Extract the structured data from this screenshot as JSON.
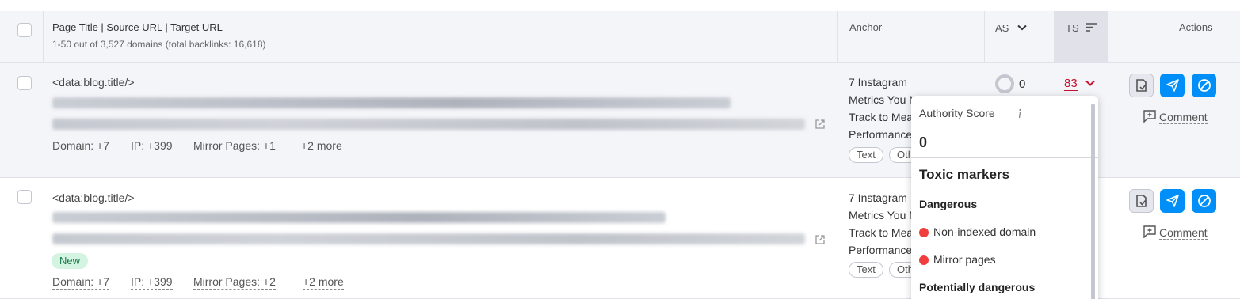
{
  "header": {
    "page_title_col": "Page Title | Source URL | Target URL",
    "summary": "1-50 out of 3,527 domains (total backlinks: 16,618)",
    "anchor_col": "Anchor",
    "as_col": "AS",
    "ts_col": "TS",
    "actions_col": "Actions"
  },
  "rows": [
    {
      "title": "<data:blog.title/>",
      "meta": [
        "Domain: +7",
        "IP: +399",
        "Mirror Pages: +1",
        "+2 more"
      ],
      "anchor": "7 Instagram Metrics You Must Track to Measure Performance",
      "tags": [
        "Text",
        "Other"
      ],
      "as": "0",
      "ts": "83",
      "comment": "Comment"
    },
    {
      "title": "<data:blog.title/>",
      "badge": "New",
      "meta": [
        "Domain: +7",
        "IP: +399",
        "Mirror Pages: +2",
        "+2 more"
      ],
      "anchor": "7 Instagram Metrics You Must Track to Measure Performance",
      "tags": [
        "Text",
        "Other"
      ],
      "comment": "Comment"
    }
  ],
  "popup": {
    "authority_label": "Authority Score",
    "authority_value": "0",
    "toxic_heading": "Toxic markers",
    "dangerous_heading": "Dangerous",
    "dangerous_items": [
      "Non-indexed domain",
      "Mirror pages"
    ],
    "potential_heading": "Potentially dangerous"
  },
  "colors": {
    "header_bg": "#f4f5f9",
    "accent_blue": "#008ff8",
    "toxic_red": "#c8102e",
    "danger_dot": "#f03d3d",
    "new_badge_bg": "#d4f4e2"
  }
}
